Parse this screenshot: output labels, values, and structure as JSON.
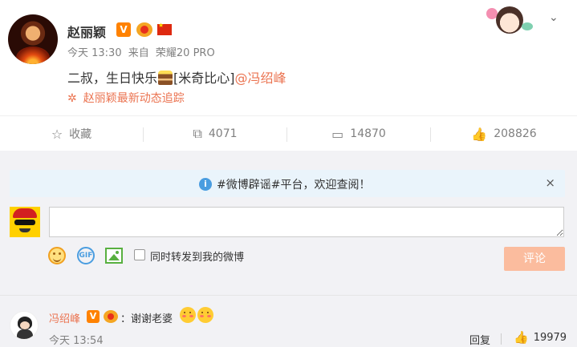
{
  "post": {
    "author": "赵丽颖",
    "badge_v": "V",
    "time": "今天 13:30",
    "source_prefix": "来自",
    "source_device": "荣耀20 PRO",
    "text_main": "二叔，生日快乐",
    "text_emoji": "[米奇比心]",
    "text_mention": "@冯绍峰",
    "tracking_icon": "✲",
    "tracking": "赵丽颖最新动态追踪"
  },
  "actions": {
    "favorite": {
      "icon": "☆",
      "label": "收藏"
    },
    "repost": {
      "icon": "⧉",
      "count": "4071"
    },
    "comment": {
      "icon": "▭",
      "count": "14870"
    },
    "like": {
      "icon": "👍",
      "count": "208826"
    }
  },
  "notice": {
    "icon": "i",
    "text": "#微博辟谣#平台，欢迎查阅！",
    "close": "×"
  },
  "composer": {
    "input_value": "",
    "gif_label": "GIF",
    "repost_checkbox_label": "同时转发到我的微博",
    "submit_label": "评论"
  },
  "comment": {
    "author": "冯绍峰",
    "badge_v": "V",
    "text": "：谢谢老婆",
    "time": "今天 13:54",
    "reply_label": "回复",
    "like_icon": "👍",
    "like_count": "19979"
  },
  "colors": {
    "accent": "#eb7350",
    "vip_orange": "#ff8200",
    "notice_bg": "#eaf4fb",
    "submit_bg": "#fbbc9e"
  }
}
